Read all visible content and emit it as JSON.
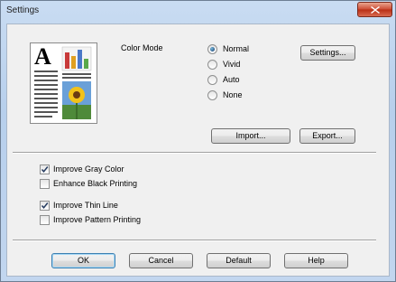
{
  "window": {
    "title": "Settings",
    "close_icon": "close-x-icon"
  },
  "preview": {
    "icon": "document-preview-icon",
    "letter": "A"
  },
  "color_mode": {
    "label": "Color Mode",
    "options": [
      {
        "label": "Normal",
        "selected": true
      },
      {
        "label": "Vivid",
        "selected": false
      },
      {
        "label": "Auto",
        "selected": false
      },
      {
        "label": "None",
        "selected": false
      }
    ]
  },
  "buttons": {
    "settings": "Settings...",
    "import": "Import...",
    "export": "Export..."
  },
  "checkboxes": [
    {
      "label": "Improve Gray Color",
      "checked": true
    },
    {
      "label": "Enhance Black Printing",
      "checked": false
    },
    {
      "label": "Improve Thin Line",
      "checked": true
    },
    {
      "label": "Improve Pattern Printing",
      "checked": false
    }
  ],
  "footer": {
    "ok": "OK",
    "cancel": "Cancel",
    "default": "Default",
    "help": "Help"
  },
  "colors": {
    "title_bar": "#bcd3ee",
    "close_button": "#c8432b",
    "client": "#f0f0f0"
  }
}
